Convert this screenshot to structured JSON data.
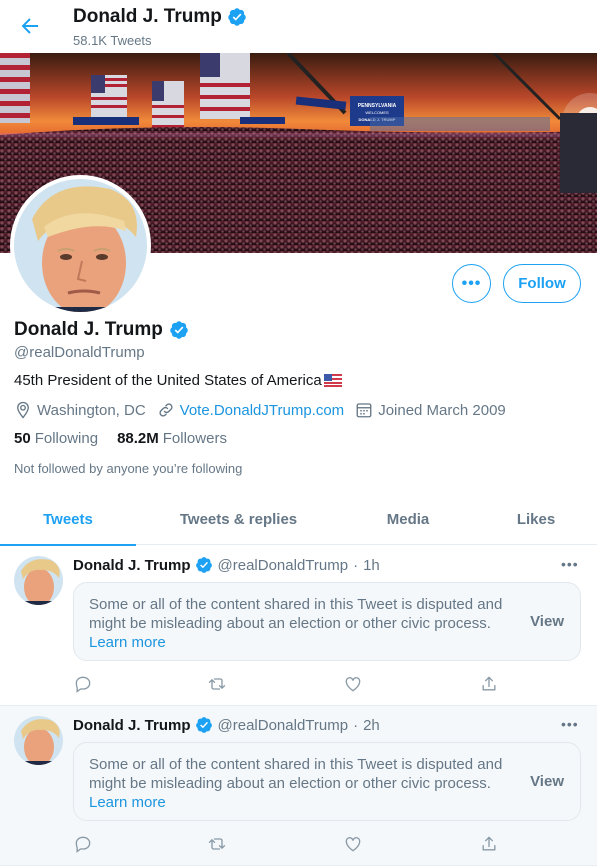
{
  "header": {
    "name": "Donald J. Trump",
    "tweet_count": "58.1K Tweets"
  },
  "banner": {
    "sign_text": [
      "PENNSYLVANIA",
      "WELCOMES",
      "DONALD J. TRUMP"
    ]
  },
  "profile": {
    "name": "Donald J. Trump",
    "handle": "@realDonaldTrump",
    "bio": "45th President of the United States of America",
    "location": "Washington, DC",
    "website": "Vote.DonaldJTrump.com",
    "joined": "Joined March 2009",
    "following_count": "50",
    "following_label": "Following",
    "followers_count": "88.2M",
    "followers_label": "Followers",
    "not_followed": "Not followed by anyone you’re following",
    "follow_label": "Follow",
    "more_label": "•••"
  },
  "tabs": [
    {
      "label": "Tweets",
      "active": true
    },
    {
      "label": "Tweets & replies",
      "active": false
    },
    {
      "label": "Media",
      "active": false
    },
    {
      "label": "Likes",
      "active": false
    }
  ],
  "tweets": [
    {
      "name": "Donald J. Trump",
      "handle": "@realDonaldTrump",
      "time": "1h",
      "notice": "Some or all of the content shared in this Tweet is disputed and might be misleading about an election or other civic process.",
      "learn_more": "Learn more",
      "view": "View"
    },
    {
      "name": "Donald J. Trump",
      "handle": "@realDonaldTrump",
      "time": "2h",
      "notice": "Some or all of the content shared in this Tweet is disputed and might be misleading about an election or other civic process.",
      "learn_more": "Learn more",
      "view": "View"
    }
  ],
  "colors": {
    "accent": "#1da1f2",
    "link": "#1b95e0",
    "muted": "#657786",
    "text": "#14171a"
  },
  "icons": [
    "back-arrow-icon",
    "verified-badge-icon",
    "location-icon",
    "link-icon",
    "calendar-icon",
    "reply-icon",
    "retweet-icon",
    "like-icon",
    "share-icon",
    "more-icon",
    "us-flag-icon"
  ]
}
